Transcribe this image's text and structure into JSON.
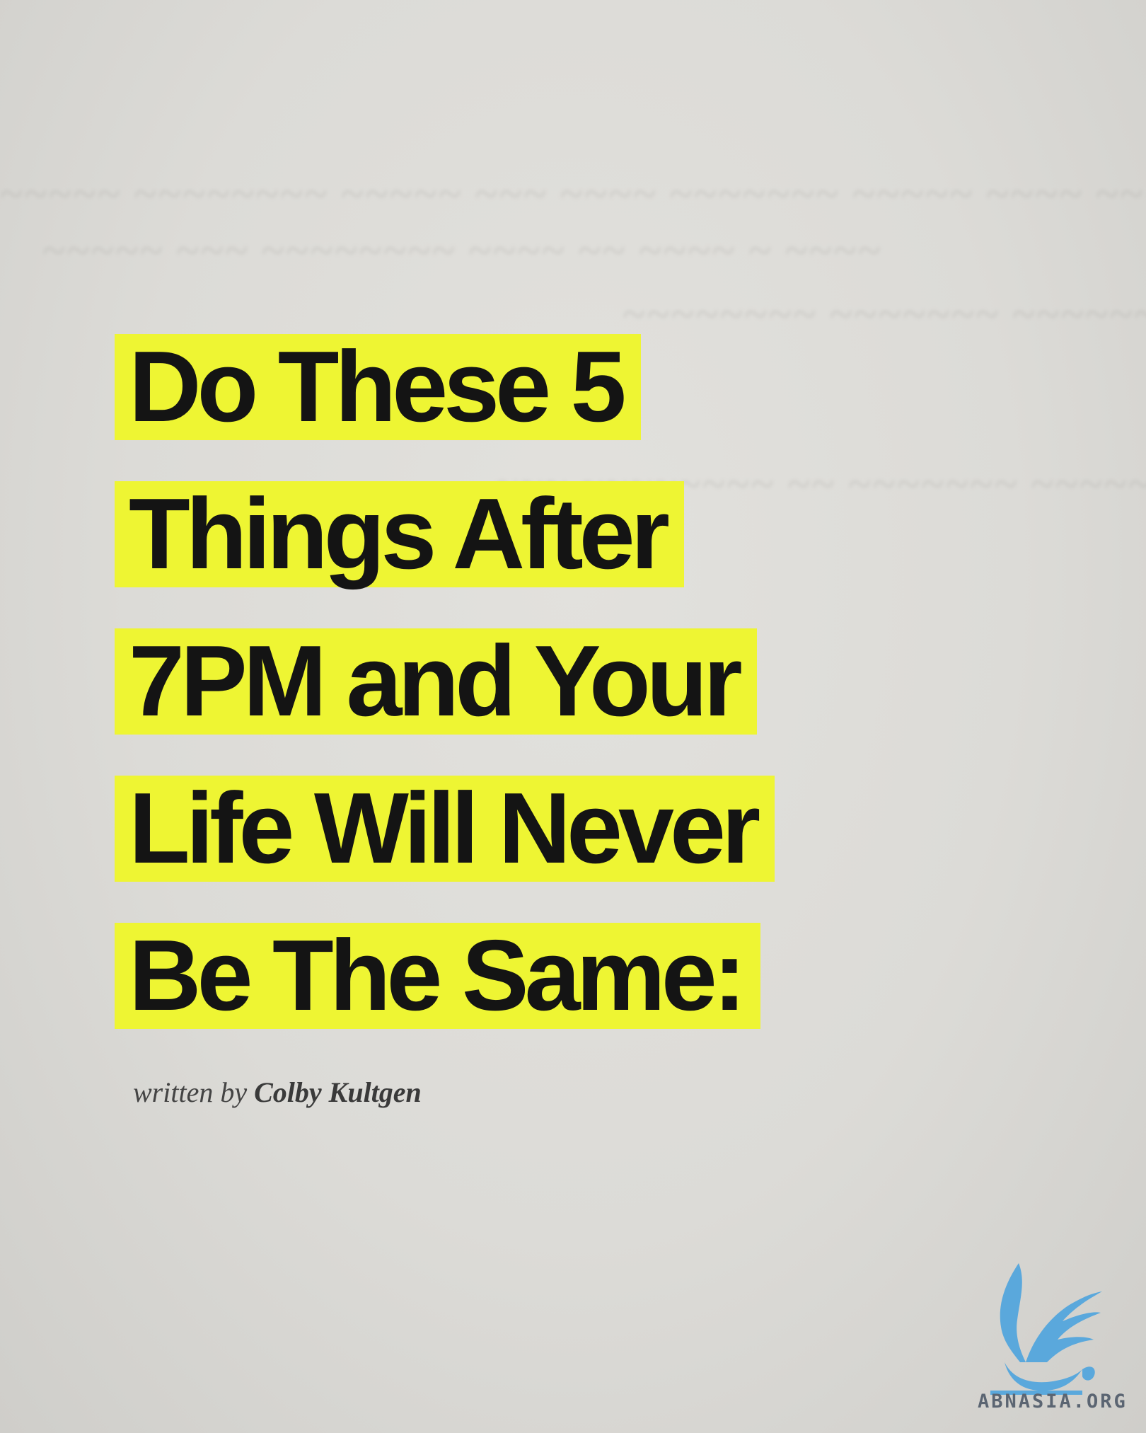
{
  "headline": {
    "lines": [
      "Do These 5",
      "Things After",
      "7PM and Your",
      "Life Will Never",
      "Be The Same:"
    ],
    "highlight_color": "#eef533",
    "text_color": "#141414"
  },
  "byline": {
    "prefix": "written by",
    "author": "Colby Kultgen"
  },
  "watermark": {
    "icon": "griffin-logo-icon",
    "text": "ABNASIA.ORG",
    "color": "#5aa8dc"
  }
}
